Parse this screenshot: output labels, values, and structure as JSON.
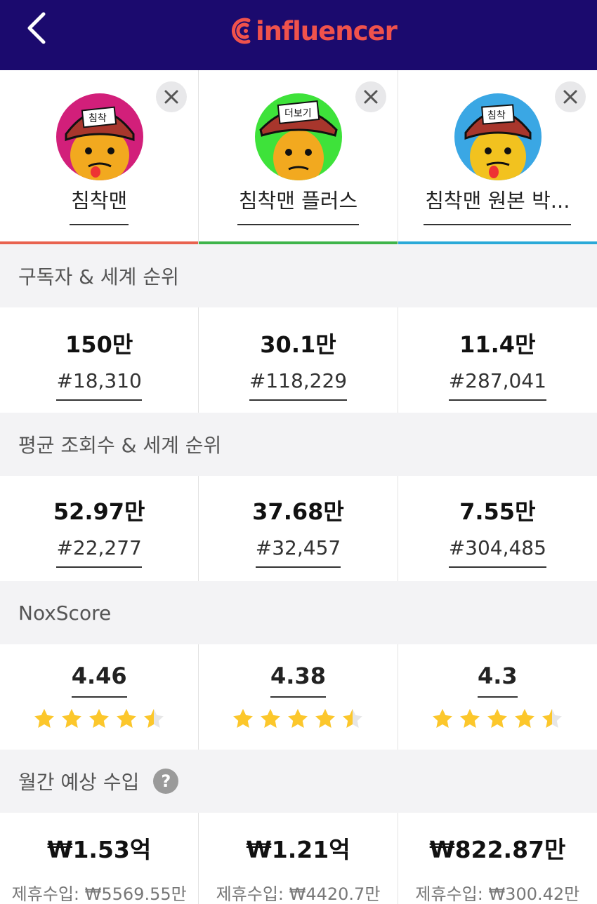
{
  "header": {
    "logo_text": "influencer",
    "bg_color": "#1b0a6e",
    "logo_color": "#f0524c"
  },
  "profiles": [
    {
      "name": "침착맨",
      "accent_color": "#e8624f",
      "avatar_bg": "#d21f7a",
      "cap_text": "침착"
    },
    {
      "name": "침착맨 플러스",
      "accent_color": "#3eb44a",
      "avatar_bg": "#3ee23a",
      "cap_text": "더보기"
    },
    {
      "name": "침착맨 원본 박...",
      "accent_color": "#2aa9d8",
      "avatar_bg": "#3aa7e4",
      "cap_text": "침착"
    }
  ],
  "sections": {
    "subscribers": "구독자 & 세계 순위",
    "avg_views": "평균 조회수 & 세계 순위",
    "nox": "NoxScore",
    "income": "월간 예상 수입",
    "help_icon": "?"
  },
  "subscribers": [
    {
      "value": "150만",
      "rank": "#18,310"
    },
    {
      "value": "30.1만",
      "rank": "#118,229"
    },
    {
      "value": "11.4만",
      "rank": "#287,041"
    }
  ],
  "avg_views": [
    {
      "value": "52.97만",
      "rank": "#22,277"
    },
    {
      "value": "37.68만",
      "rank": "#32,457"
    },
    {
      "value": "7.55만",
      "rank": "#304,485"
    }
  ],
  "nox": [
    {
      "score": "4.46",
      "stars": 4.5
    },
    {
      "score": "4.38",
      "stars": 4.5
    },
    {
      "score": "4.3",
      "stars": 4.5
    }
  ],
  "income": [
    {
      "value": "₩1.53억",
      "partner": "제휴수입: ₩5569.55만"
    },
    {
      "value": "₩1.21억",
      "partner": "제휴수입: ₩4420.7만"
    },
    {
      "value": "₩822.87만",
      "partner": "제휴수입: ₩300.42만"
    }
  ],
  "colors": {
    "star": "#fcc72b",
    "star_empty": "#e6e6e6"
  }
}
